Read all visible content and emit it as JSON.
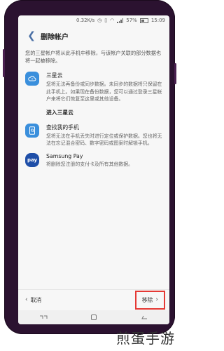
{
  "status_bar": {
    "speed": "0.32K/s",
    "battery": "57%",
    "time": "15:09"
  },
  "header": {
    "title": "删除帐户"
  },
  "intro": "您的三星帐户将从此手机中移除，与该帐户关联的部分数据也将一起被移除。",
  "items": [
    {
      "title": "三星云",
      "desc": "您将无法再备份或同步数据。未同步的数据将只保留在此手机上。如果现在备份数据，您可以通过登录三星帐户来将它们恢复至这里或其他设备。",
      "icon": "cloud-icon",
      "color": "#3a8fdc"
    },
    {
      "title": "查找我的手机",
      "desc": "您将无法在手机丢失时进行定位或保护数据。您也将无法在忘记混合密码、数字密码或图案时解锁手机。",
      "icon": "find-phone-icon",
      "color": "#3a8fdc"
    },
    {
      "title": "Samsung Pay",
      "desc": "将删除您注册的支付卡及所有其他数据。",
      "icon": "pay-icon",
      "color": "#1f4fa8",
      "icon_text": "pay"
    }
  ],
  "link": "进入三星云",
  "buttons": {
    "cancel": "取消",
    "remove": "移除"
  },
  "watermark": "煎蛋手游"
}
